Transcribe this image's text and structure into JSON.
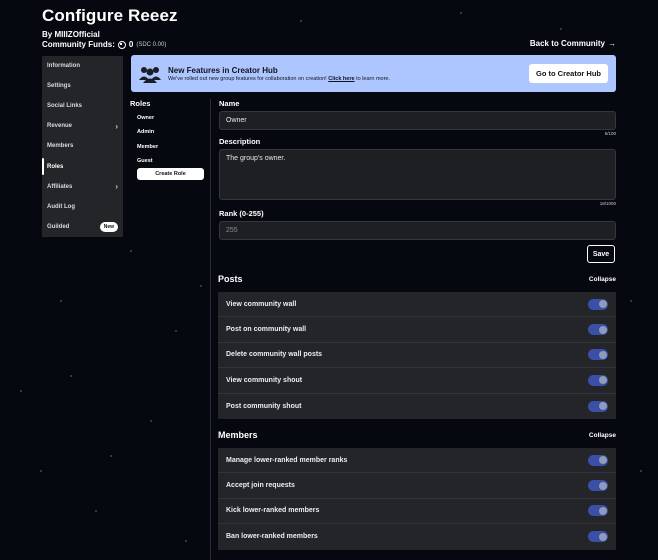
{
  "header": {
    "title": "Configure Reeez",
    "byline_prefix": "By",
    "owner": "MIIIZOfficial",
    "funds_label": "Community Funds:",
    "funds_value": "0",
    "funds_pending": "(SDC 0.00)",
    "back_link": "Back to Community"
  },
  "sidebar": {
    "items": [
      {
        "label": "Information"
      },
      {
        "label": "Settings"
      },
      {
        "label": "Social Links"
      },
      {
        "label": "Revenue"
      },
      {
        "label": "Members"
      },
      {
        "label": "Roles"
      },
      {
        "label": "Affiliates"
      },
      {
        "label": "Audit Log"
      },
      {
        "label": "Guilded"
      }
    ],
    "new_badge": "New"
  },
  "banner": {
    "title": "New Features in Creator Hub",
    "desc_prefix": "We've rolled out new group features for collaboration on creation!",
    "link": "Click here",
    "desc_suffix": "to learn more.",
    "button": "Go to Creator Hub"
  },
  "roles": {
    "heading": "Roles",
    "items": [
      "Owner",
      "Admin",
      "Member",
      "Guest"
    ],
    "create_button": "Create Role"
  },
  "form": {
    "name_label": "Name",
    "name_value": "Owner",
    "name_counter": "5/100",
    "description_label": "Description",
    "description_value": "The group's owner.",
    "description_counter": "18/1000",
    "rank_label": "Rank (0-255)",
    "rank_value": "255",
    "save_button": "Save"
  },
  "sections": [
    {
      "title": "Posts",
      "collapse": "Collapse",
      "permissions": [
        {
          "label": "View community wall",
          "enabled": true
        },
        {
          "label": "Post on community wall",
          "enabled": true
        },
        {
          "label": "Delete community wall posts",
          "enabled": true
        },
        {
          "label": "View community shout",
          "enabled": true
        },
        {
          "label": "Post community shout",
          "enabled": true
        }
      ]
    },
    {
      "title": "Members",
      "collapse": "Collapse",
      "permissions": [
        {
          "label": "Manage lower-ranked member ranks",
          "enabled": true
        },
        {
          "label": "Accept join requests",
          "enabled": true
        },
        {
          "label": "Kick lower-ranked members",
          "enabled": true
        },
        {
          "label": "Ban lower-ranked members",
          "enabled": true
        }
      ]
    }
  ],
  "colors": {
    "background": "#06080f",
    "panel": "#232529",
    "banner": "#aec6ff",
    "toggle_on": "#3b4fa8"
  }
}
